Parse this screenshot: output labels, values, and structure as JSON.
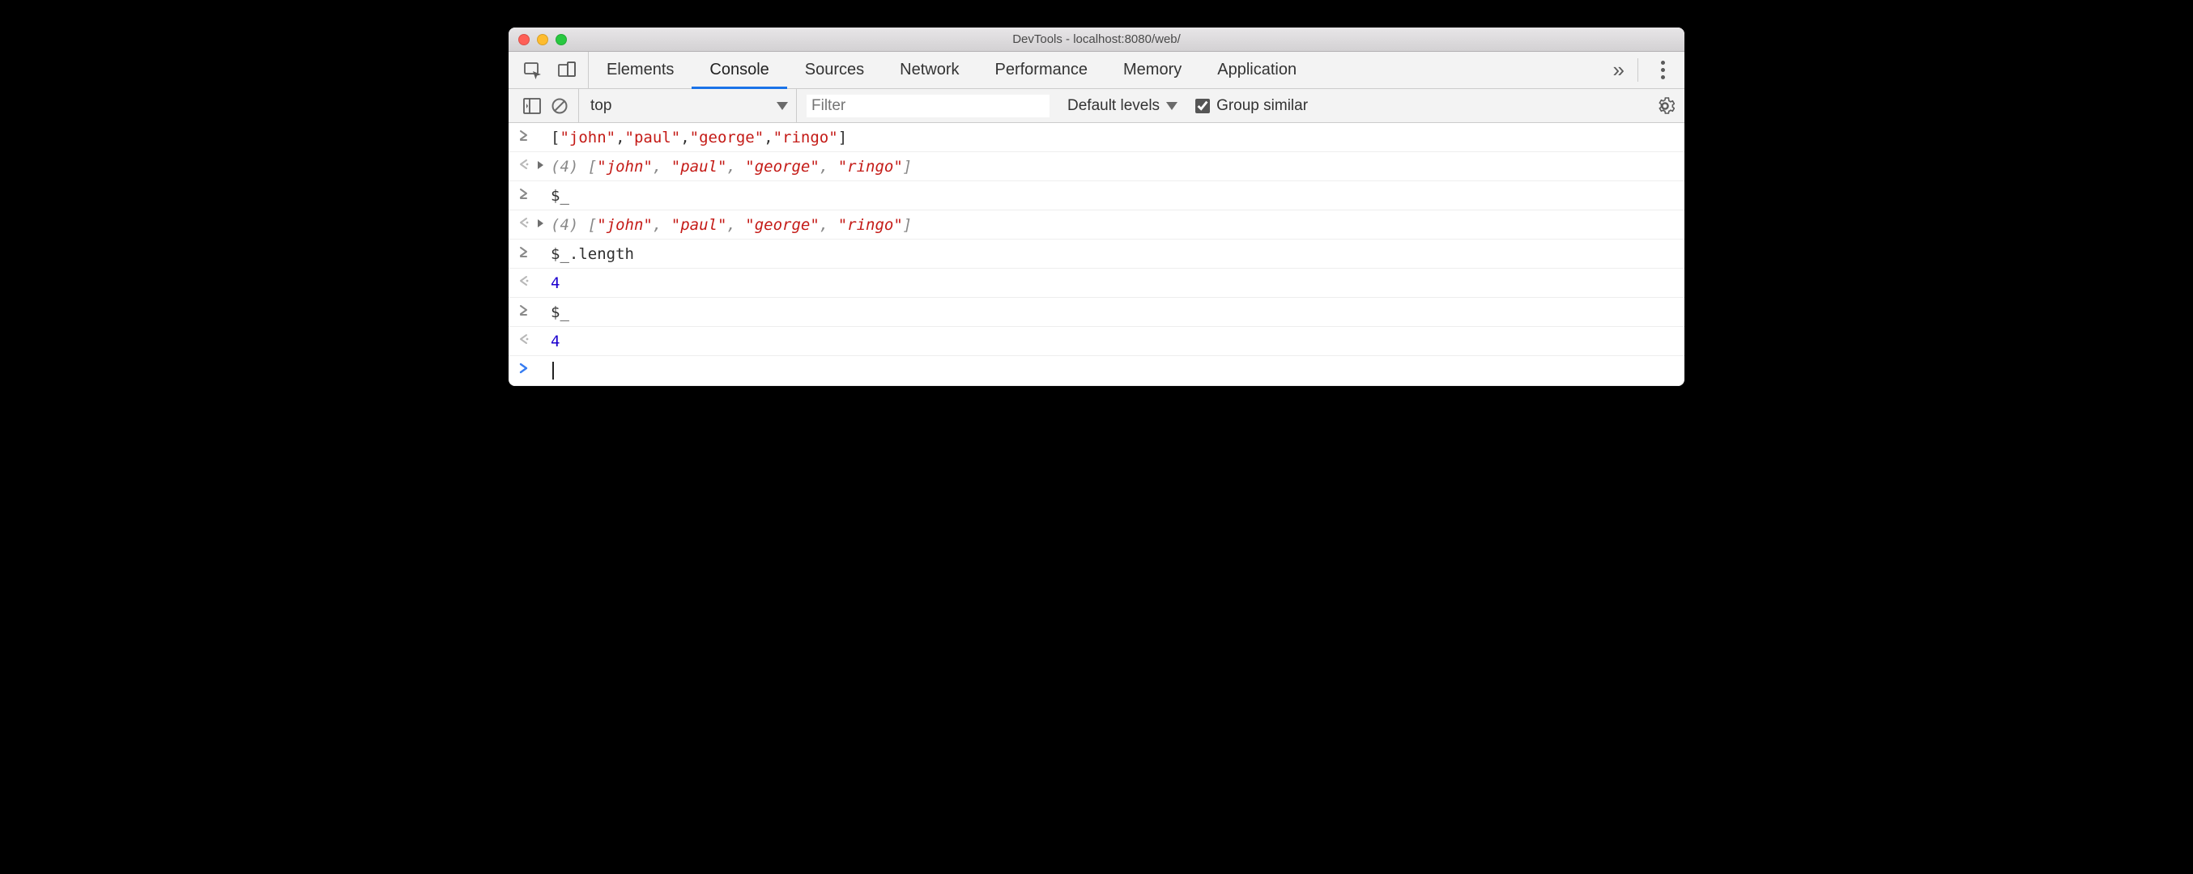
{
  "window": {
    "title": "DevTools - localhost:8080/web/"
  },
  "tabs": {
    "items": [
      "Elements",
      "Console",
      "Sources",
      "Network",
      "Performance",
      "Memory",
      "Application"
    ],
    "active_index": 1
  },
  "toolbar": {
    "context": "top",
    "filter_placeholder": "Filter",
    "levels_label": "Default levels",
    "group_similar_label": "Group similar",
    "group_similar_checked": true
  },
  "console": {
    "rows": [
      {
        "kind": "input",
        "text_parts": [
          "[",
          {
            "s": "\"john\""
          },
          ",",
          {
            "s": "\"paul\""
          },
          ",",
          {
            "s": "\"george\""
          },
          ",",
          {
            "s": "\"ringo\""
          },
          "]"
        ]
      },
      {
        "kind": "result",
        "expandable": true,
        "count": "(4)",
        "text_parts": [
          " [",
          {
            "s": "\"john\""
          },
          ", ",
          {
            "s": "\"paul\""
          },
          ", ",
          {
            "s": "\"george\""
          },
          ", ",
          {
            "s": "\"ringo\""
          },
          "]"
        ],
        "italic": true
      },
      {
        "kind": "input",
        "text_parts": [
          "$_"
        ]
      },
      {
        "kind": "result",
        "expandable": true,
        "count": "(4)",
        "text_parts": [
          " [",
          {
            "s": "\"john\""
          },
          ", ",
          {
            "s": "\"paul\""
          },
          ", ",
          {
            "s": "\"george\""
          },
          ", ",
          {
            "s": "\"ringo\""
          },
          "]"
        ],
        "italic": true
      },
      {
        "kind": "input",
        "text_parts": [
          "$_.length"
        ]
      },
      {
        "kind": "result",
        "text_parts": [
          {
            "n": "4"
          }
        ]
      },
      {
        "kind": "input",
        "text_parts": [
          "$_"
        ]
      },
      {
        "kind": "result",
        "text_parts": [
          {
            "n": "4"
          }
        ]
      }
    ]
  }
}
